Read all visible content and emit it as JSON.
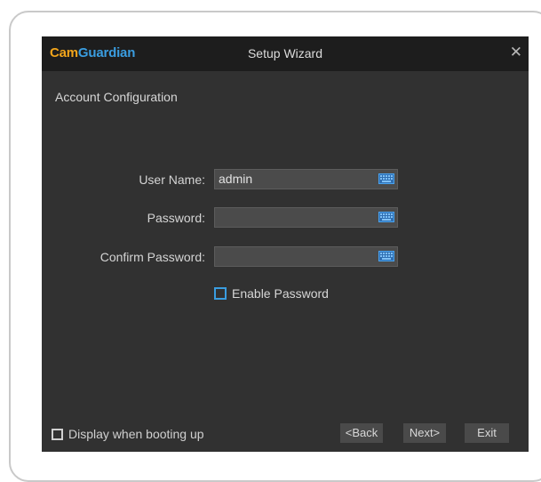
{
  "window": {
    "brand_part1": "Cam",
    "brand_part2": "Guardian",
    "title": "Setup Wizard",
    "close_glyph": "✕"
  },
  "section": {
    "title": "Account Configuration"
  },
  "form": {
    "username_label": "User Name:",
    "username_value": "admin",
    "password_label": "Password:",
    "password_value": "",
    "confirm_label": "Confirm Password:",
    "confirm_value": "",
    "enable_password_label": "Enable Password",
    "enable_password_checked": false
  },
  "footer": {
    "display_boot_label": "Display when booting up",
    "display_boot_checked": false,
    "back_label": "<Back",
    "next_label": "Next>",
    "exit_label": "Exit"
  },
  "colors": {
    "brand_orange": "#f2a51b",
    "brand_blue": "#3a9de0",
    "dialog_bg": "#313131",
    "titlebar_bg": "#1d1d1d",
    "field_bg": "#4b4b4b"
  },
  "icons": {
    "keyboard": "keyboard-icon",
    "close": "close-icon",
    "checkbox": "checkbox-icon"
  }
}
